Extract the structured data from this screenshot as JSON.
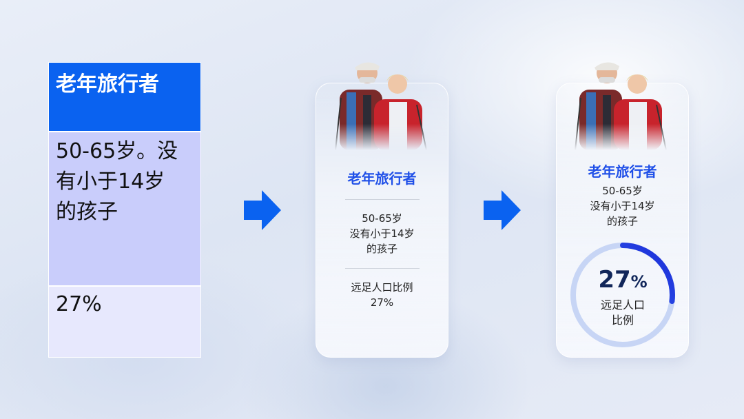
{
  "table": {
    "header": "老年旅行者",
    "body_lines": [
      "50-65岁。没",
      "有小于14岁",
      "的孩子"
    ],
    "footer": "27%"
  },
  "card1": {
    "title": "老年旅行者",
    "desc_lines": [
      "50-65岁",
      "没有小于14岁",
      "的孩子"
    ],
    "stat_lines": [
      "远足人口比例",
      "27%"
    ]
  },
  "card2": {
    "title": "老年旅行者",
    "desc_lines": [
      "50-65岁",
      "没有小于14岁",
      "的孩子"
    ],
    "stat_number": "27",
    "stat_unit": "%",
    "stat_value": 27,
    "stat_label_lines": [
      "远足人口",
      "比例"
    ]
  },
  "colors": {
    "accent_blue": "#0a62f0",
    "title_blue": "#1f4fe8",
    "ring_track": "#c7d5f5",
    "ring_fill_start": "#3d7bff",
    "ring_fill_end": "#1b2bd6"
  },
  "icons": {
    "arrow": "arrow-right-icon",
    "photo": "senior-hikers-photo"
  }
}
